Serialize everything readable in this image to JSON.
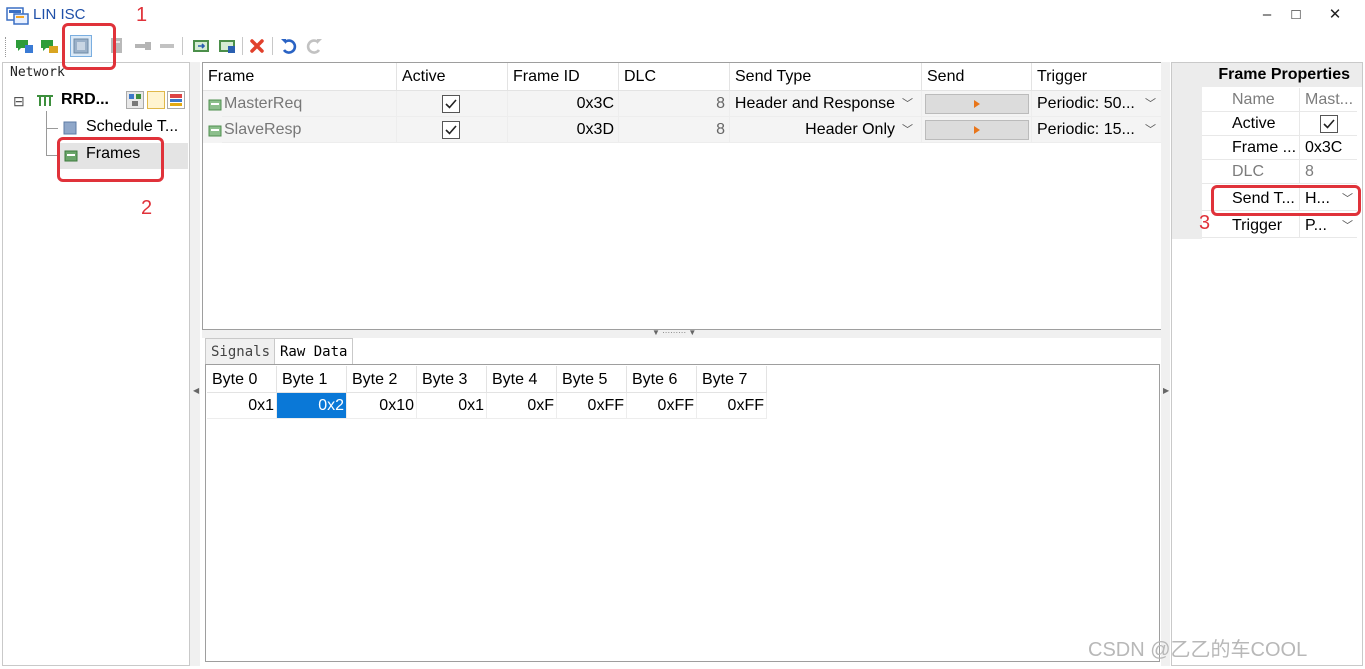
{
  "window": {
    "title": "LIN ISC",
    "controls": {
      "minimize": "–",
      "maximize": "□",
      "close": "✕"
    }
  },
  "toolbar": {
    "icons": [
      "add-frame-icon",
      "add-frame-alt-icon",
      "frame-editor-icon",
      "doc-icon",
      "key-icon",
      "minus-icon",
      "import-icon",
      "export-icon",
      "delete-icon",
      "undo-icon",
      "redo-icon"
    ]
  },
  "network": {
    "header": "Network",
    "tree": {
      "root": {
        "expander": "⊟",
        "label": "RRD..."
      },
      "children": [
        {
          "label": "Schedule T..."
        },
        {
          "label": "Frames"
        }
      ]
    }
  },
  "frames": {
    "columns": [
      "Frame",
      "Active",
      "Frame ID",
      "DLC",
      "Send Type",
      "Send",
      "Trigger"
    ],
    "rows": [
      {
        "frame": "MasterReq",
        "active": true,
        "frame_id": "0x3C",
        "dlc": "8",
        "send_type": "Header and Response",
        "trigger": "Periodic: 50..."
      },
      {
        "frame": "SlaveResp",
        "active": true,
        "frame_id": "0x3D",
        "dlc": "8",
        "send_type": "Header Only",
        "trigger": "Periodic: 15..."
      }
    ]
  },
  "tabs": [
    {
      "label": "Signals",
      "active": false
    },
    {
      "label": "Raw Data",
      "active": true
    }
  ],
  "raw_data": {
    "columns": [
      "Byte 0",
      "Byte 1",
      "Byte 2",
      "Byte 3",
      "Byte 4",
      "Byte 5",
      "Byte 6",
      "Byte 7"
    ],
    "values": [
      "0x1",
      "0x2",
      "0x10",
      "0x1",
      "0xF",
      "0xFF",
      "0xFF",
      "0xFF"
    ],
    "selected_index": 1
  },
  "properties": {
    "title": "Frame Properties",
    "rows": [
      {
        "key": "Name",
        "value": "Mast...",
        "readonly": true
      },
      {
        "key": "Active",
        "value": "",
        "checkbox": true
      },
      {
        "key": "Frame ...",
        "value": "0x3C"
      },
      {
        "key": "DLC",
        "value": "8",
        "readonly": true
      },
      {
        "key": "Send T...",
        "value": "H...",
        "dropdown": true
      },
      {
        "key": "Trigger",
        "value": "P...",
        "dropdown": true
      }
    ]
  },
  "annotations": [
    "1",
    "2",
    "3"
  ],
  "watermark": "CSDN @乙乙的车COOL",
  "colors": {
    "accent": "#0a78d7",
    "annotation": "#e0323a",
    "title_text": "#1e4fa8"
  }
}
